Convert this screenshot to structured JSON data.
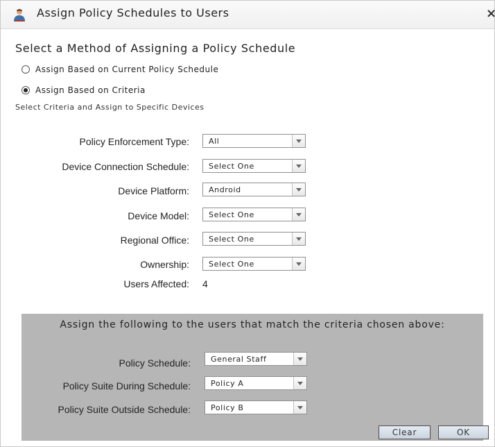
{
  "dialog": {
    "title": "Assign Policy Schedules to Users",
    "close": "×",
    "heading": "Select a Method of Assigning a Policy Schedule",
    "options": [
      {
        "label": "Assign Based on Current Policy Schedule",
        "selected": false
      },
      {
        "label": "Assign Based on Criteria",
        "selected": true
      }
    ],
    "criteria_note": "Select Criteria and Assign to Specific Devices"
  },
  "criteria": {
    "policy_enforcement_type": {
      "label": "Policy Enforcement Type:",
      "value": "All"
    },
    "device_connection_schedule": {
      "label": "Device Connection Schedule:",
      "value": "Select One"
    },
    "device_platform": {
      "label": "Device Platform:",
      "value": "Android"
    },
    "device_model": {
      "label": "Device Model:",
      "value": "Select One"
    },
    "regional_office": {
      "label": "Regional Office:",
      "value": "Select One"
    },
    "ownership": {
      "label": "Ownership:",
      "value": "Select One"
    },
    "users_affected": {
      "label": "Users Affected:",
      "value": "4"
    }
  },
  "assign": {
    "title": "Assign the following to the users that match the criteria chosen above:",
    "policy_schedule": {
      "label": "Policy Schedule:",
      "value": "General Staff"
    },
    "suite_during": {
      "label": "Policy Suite During Schedule:",
      "value": "Policy A"
    },
    "suite_outside": {
      "label": "Policy Suite Outside Schedule:",
      "value": "Policy B"
    },
    "clear_label": "Clear",
    "ok_label": "OK"
  },
  "colors": {
    "panel": "#b6b6b6",
    "button_border": "#4c4c4c"
  },
  "icons": {
    "title": "user-icon",
    "dropdown": "chevron-down-icon"
  }
}
